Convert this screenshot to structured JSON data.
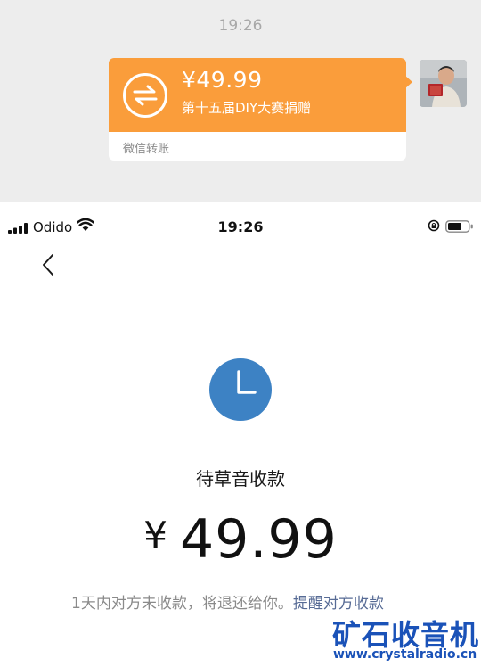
{
  "chat": {
    "time": "19:26",
    "transfer_card": {
      "amount": "¥49.99",
      "description": "第十五届DIY大赛捐赠",
      "label": "微信转账",
      "color": "#fa9d3b"
    },
    "avatar_icon": "user-avatar"
  },
  "status_bar": {
    "carrier": "Odido",
    "time": "19:26",
    "icons": [
      "signal-icon",
      "wifi-icon",
      "rotation-lock-icon",
      "battery-icon"
    ]
  },
  "detail": {
    "back_icon": "chevron-left-icon",
    "status_icon": "clock-icon",
    "status_color": "#3d82c4",
    "status_title": "待草音收款",
    "currency": "¥",
    "amount": "49.99",
    "notice": "1天内对方未收款，将退还给你。",
    "remind_link": "提醒对方收款",
    "link_color": "#576b95"
  },
  "watermark": {
    "title": "矿石收音机",
    "url": "www.crystalradio.cn"
  }
}
